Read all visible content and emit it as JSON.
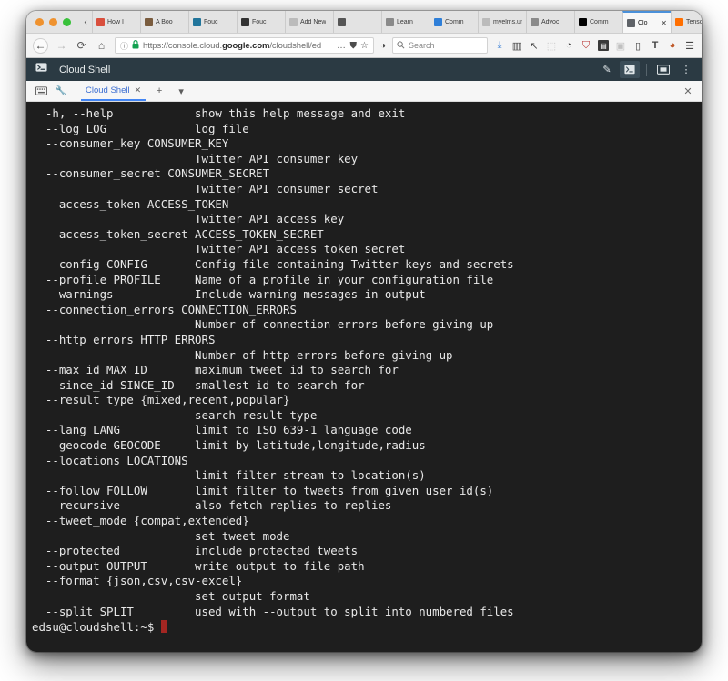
{
  "browser": {
    "traffic_lights": [
      "close-orange",
      "minimize-orange",
      "zoom-green"
    ],
    "scroll_left_icon": "‹",
    "scroll_right_icon": "›",
    "new_tab_icon": "+",
    "tab_list_icon": "⌄",
    "tabs": [
      {
        "label": "How I",
        "favicon": "bookmark-icon",
        "favicon_color": "#d94f3d",
        "active": false,
        "closable": false
      },
      {
        "label": "A Boo",
        "favicon": "book-icon",
        "favicon_color": "#7a5c3e",
        "active": false,
        "closable": false
      },
      {
        "label": "Fouc",
        "favicon": "wordpress-icon",
        "favicon_color": "#21759b",
        "active": false,
        "closable": false
      },
      {
        "label": "Fouc",
        "favicon": "globe-icon",
        "favicon_color": "#333333",
        "active": false,
        "closable": false
      },
      {
        "label": "Add New",
        "favicon": "blank-icon",
        "favicon_color": "#bbbbbb",
        "active": false,
        "closable": false
      },
      {
        "label": "",
        "favicon": "media-player-icon",
        "favicon_color": "#555555",
        "active": false,
        "closable": false
      },
      {
        "label": "Learn",
        "favicon": "mit-icon",
        "favicon_color": "#8a8a8a",
        "active": false,
        "closable": false
      },
      {
        "label": "Comm",
        "favicon": "mail-icon",
        "favicon_color": "#2f7fd8",
        "active": false,
        "closable": false
      },
      {
        "label": "myelms.un",
        "favicon": "blank-icon",
        "favicon_color": "#bbbbbb",
        "active": false,
        "closable": false
      },
      {
        "label": "Advoc",
        "favicon": "mit-icon",
        "favicon_color": "#8a8a8a",
        "active": false,
        "closable": false
      },
      {
        "label": "Comm",
        "favicon": "wikipedia-icon",
        "favicon_color": "#000000",
        "active": false,
        "closable": false
      },
      {
        "label": "Clo",
        "favicon": "cloud-console-icon",
        "favicon_color": "#5f6368",
        "active": true,
        "closable": true
      },
      {
        "label": "Tenso",
        "favicon": "tensorflow-icon",
        "favicon_color": "#ff6f00",
        "active": false,
        "closable": false
      }
    ],
    "nav": {
      "back_icon": "←",
      "forward_icon": "→",
      "reload_icon": "⟳",
      "home_icon": "⌂",
      "info_icon": "ⓘ",
      "lock_icon": "lock-icon",
      "url_prefix": "https://console.cloud.",
      "url_domain": "google.com",
      "url_suffix": "/cloudshell/ed",
      "page_actions_icon": "…",
      "pocket_icon": "shield-icon",
      "bookmark_star_icon": "☆",
      "container_icon": "◑"
    },
    "search": {
      "icon": "search-icon",
      "placeholder": "Search",
      "value": ""
    },
    "toolbar_icons": [
      "downloads-icon",
      "library-icon",
      "pointer-icon",
      "screenshot-icon",
      "history-icon",
      "ublock-icon",
      "trash-icon",
      "cc-icon",
      "reader-icon",
      "text-icon",
      "palette-icon",
      "menu-icon"
    ]
  },
  "cloudshell": {
    "logo_icon": "cloud-shell-prompt-icon",
    "title": "Cloud Shell",
    "header_icons": [
      {
        "name": "pencil-icon",
        "glyph": "✏",
        "selected": false
      },
      {
        "name": "terminal-icon",
        "glyph": "▶_",
        "selected": true
      },
      {
        "name": "new-window-icon",
        "glyph": "⧉",
        "selected": false
      },
      {
        "name": "more-vert-icon",
        "glyph": "⋮",
        "selected": false
      }
    ],
    "tabbar": {
      "keyboard_icon": "keyboard-icon",
      "wrench_icon": "wrench-icon",
      "tab_label": "Cloud Shell",
      "tab_close_icon": "✕",
      "add_tab_icon": "+",
      "tab_menu_icon": "▾",
      "close_icon": "✕"
    }
  },
  "terminal": {
    "prompt": "edsu@cloudshell:~$",
    "cursor": "block-cursor",
    "cursor_color": "#a32622",
    "background": "#1e1e1e",
    "foreground": "#e8e8e8",
    "lines": [
      "  -h, --help            show this help message and exit",
      "  --log LOG             log file",
      "  --consumer_key CONSUMER_KEY",
      "                        Twitter API consumer key",
      "  --consumer_secret CONSUMER_SECRET",
      "                        Twitter API consumer secret",
      "  --access_token ACCESS_TOKEN",
      "                        Twitter API access key",
      "  --access_token_secret ACCESS_TOKEN_SECRET",
      "                        Twitter API access token secret",
      "  --config CONFIG       Config file containing Twitter keys and secrets",
      "  --profile PROFILE     Name of a profile in your configuration file",
      "  --warnings            Include warning messages in output",
      "  --connection_errors CONNECTION_ERRORS",
      "                        Number of connection errors before giving up",
      "  --http_errors HTTP_ERRORS",
      "                        Number of http errors before giving up",
      "  --max_id MAX_ID       maximum tweet id to search for",
      "  --since_id SINCE_ID   smallest id to search for",
      "  --result_type {mixed,recent,popular}",
      "                        search result type",
      "  --lang LANG           limit to ISO 639-1 language code",
      "  --geocode GEOCODE     limit by latitude,longitude,radius",
      "  --locations LOCATIONS",
      "                        limit filter stream to location(s)",
      "  --follow FOLLOW       limit filter to tweets from given user id(s)",
      "  --recursive           also fetch replies to replies",
      "  --tweet_mode {compat,extended}",
      "                        set tweet mode",
      "  --protected           include protected tweets",
      "  --output OUTPUT       write output to file path",
      "  --format {json,csv,csv-excel}",
      "                        set output format",
      "  --split SPLIT         used with --output to split into numbered files"
    ]
  }
}
